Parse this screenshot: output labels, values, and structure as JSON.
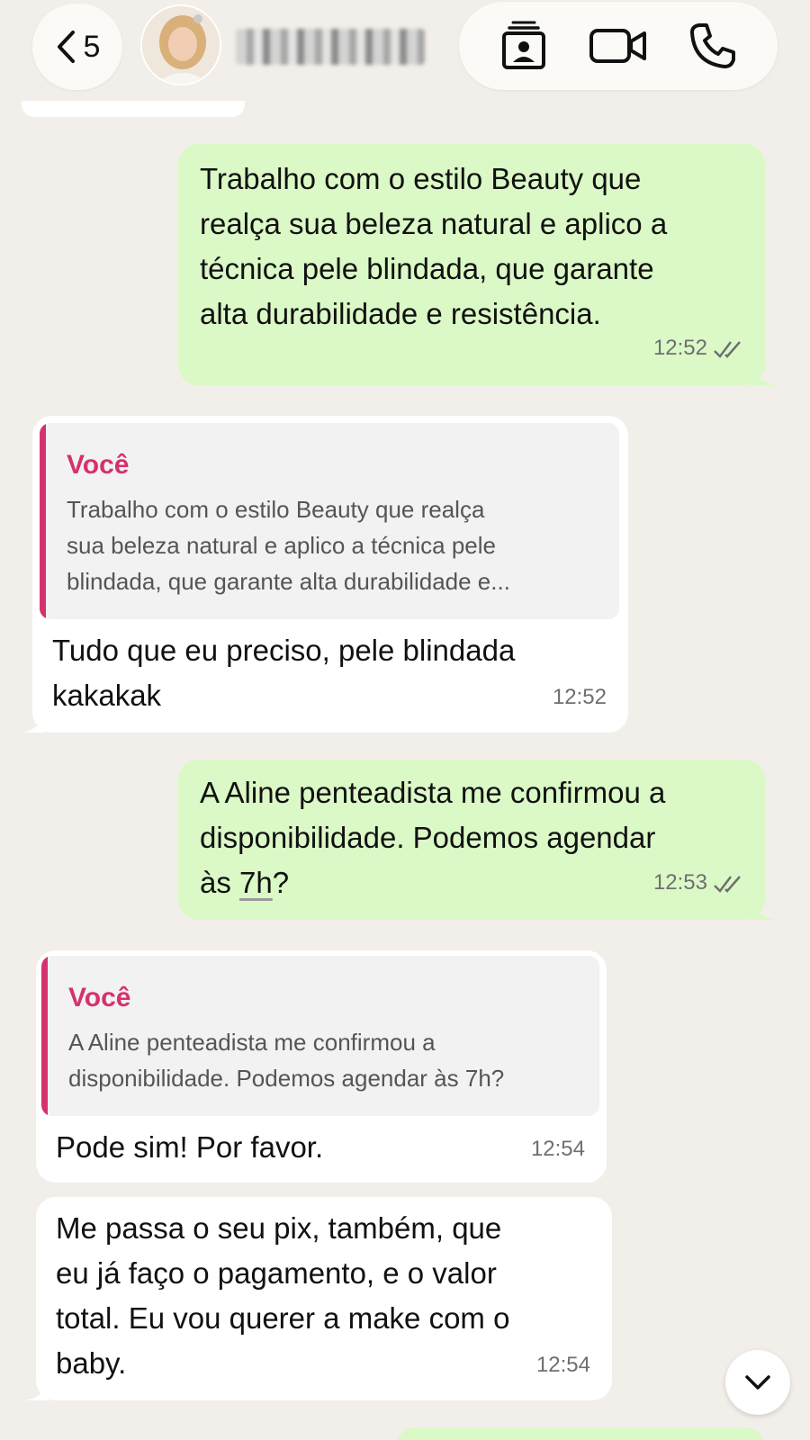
{
  "header": {
    "unread_count": "5",
    "contact_name": "",
    "icons": [
      "chevron-left-icon",
      "contact-card-icon",
      "video-call-icon",
      "phone-icon"
    ]
  },
  "colors": {
    "background": "#f2efea",
    "outgoing_bubble": "#dbf9c6",
    "incoming_bubble": "#ffffff",
    "quote_accent": "#d6316f"
  },
  "messages": [
    {
      "direction": "outgoing",
      "lines": [
        "Trabalho com o estilo Beauty que",
        "realça sua beleza natural e aplico a",
        "técnica pele blindada, que garante",
        "alta durabilidade e resistência."
      ],
      "time": "12:52",
      "status": "read"
    },
    {
      "direction": "incoming",
      "quote_author": "Você",
      "quote_lines": [
        "Trabalho com o estilo Beauty que realça",
        "sua beleza natural e aplico a técnica pele",
        "blindada, que garante alta durabilidade e..."
      ],
      "lines": [
        "Tudo que eu preciso, pele blindada",
        "kakakak"
      ],
      "time": "12:52"
    },
    {
      "direction": "outgoing",
      "lines": [
        "A Aline penteadista me confirmou a",
        "disponibilidade. Podemos agendar",
        "às 7h?"
      ],
      "time": "12:53",
      "status": "read"
    },
    {
      "direction": "incoming",
      "quote_author": "Você",
      "quote_lines": [
        "A Aline penteadista me confirmou a",
        "disponibilidade. Podemos agendar às 7h?"
      ],
      "lines": [
        "Pode sim! Por favor."
      ],
      "time": "12:54"
    },
    {
      "direction": "incoming",
      "lines": [
        "Me passa o seu pix, também, que",
        "eu já faço o pagamento, e o valor",
        "total. Eu vou querer a make com o",
        "baby."
      ],
      "time": "12:54"
    }
  ]
}
